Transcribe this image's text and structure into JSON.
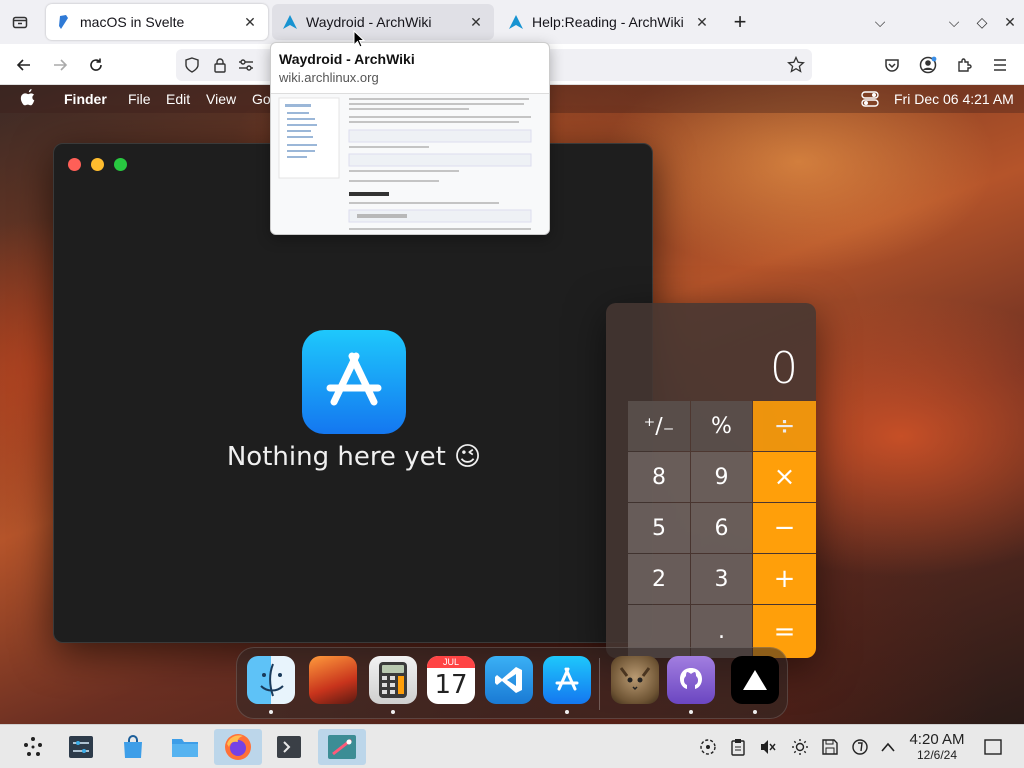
{
  "browser": {
    "tabs": [
      {
        "title": "macOS in Svelte",
        "state": "active"
      },
      {
        "title": "Waydroid - ArchWiki",
        "state": "hover"
      },
      {
        "title": "Help:Reading - ArchWiki",
        "state": "inactive"
      }
    ]
  },
  "preview": {
    "title": "Waydroid - ArchWiki",
    "url": "wiki.archlinux.org"
  },
  "menubar": {
    "app_name": "Finder",
    "menus": [
      "File",
      "Edit",
      "View",
      "Go"
    ],
    "clock": "Fri Dec 06  4:21 AM"
  },
  "app_window": {
    "message": "Nothing here yet 😉"
  },
  "calculator": {
    "display": "0",
    "keys": {
      "row1": [
        "⁺∕₋",
        "%",
        "÷"
      ],
      "row2": [
        "8",
        "9",
        "×"
      ],
      "row3": [
        "5",
        "6",
        "−"
      ],
      "row4": [
        "2",
        "3",
        "+"
      ],
      "row5": [
        "",
        ".",
        "="
      ]
    }
  },
  "dock": {
    "apps": [
      "finder-icon",
      "wallpapers-icon",
      "calculator-icon",
      "calendar-icon",
      "vscode-icon",
      "appstore-icon",
      "cat-icon",
      "github-icon",
      "vercel-icon"
    ],
    "calendar_month": "JUL",
    "calendar_day": "17"
  },
  "taskbar": {
    "time": "4:20 AM",
    "date": "12/6/24"
  },
  "colors": {
    "accent_orange": "#ff9f0a",
    "appstore_blue": "#1477f0",
    "taskbar_active": "#bcd6ea"
  }
}
